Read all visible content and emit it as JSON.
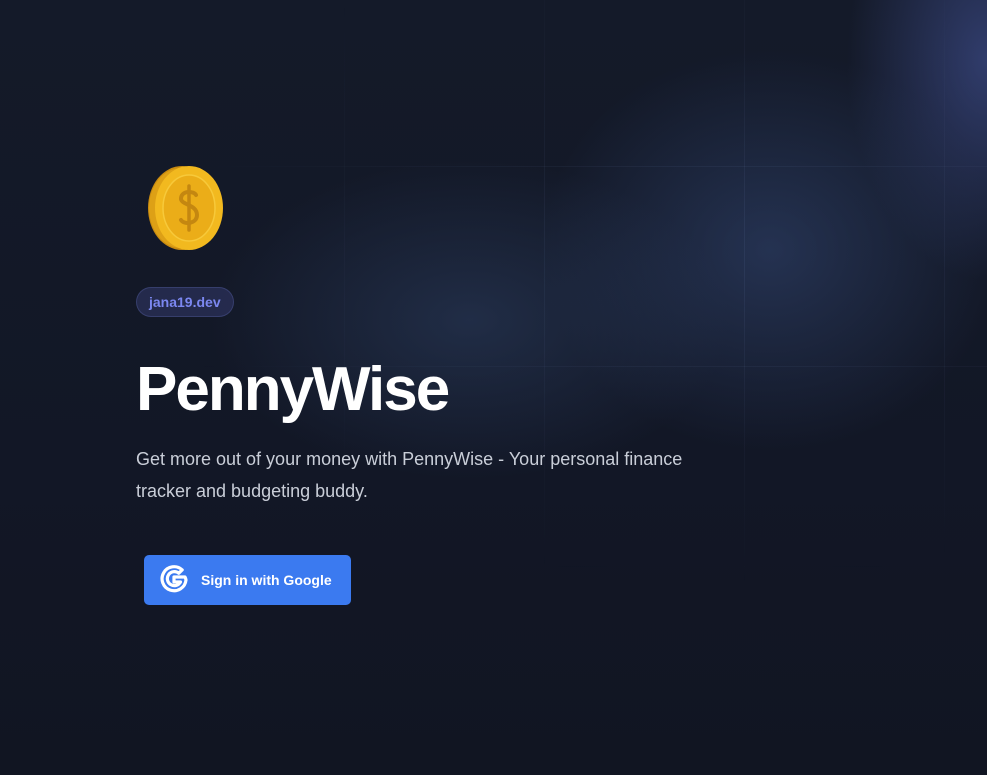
{
  "app": {
    "badge": "jana19.dev",
    "title": "PennyWise",
    "description": "Get more out of your money with PennyWise - Your personal finance tracker and budgeting buddy.",
    "logo_icon": "coin-dollar-icon"
  },
  "auth": {
    "google_button_label": "Sign in with Google",
    "google_icon": "google-g-icon"
  },
  "colors": {
    "background": "#111624",
    "accent": "#3b7af0",
    "badge_text": "#7b87f0",
    "coin": "#f2b91f"
  }
}
